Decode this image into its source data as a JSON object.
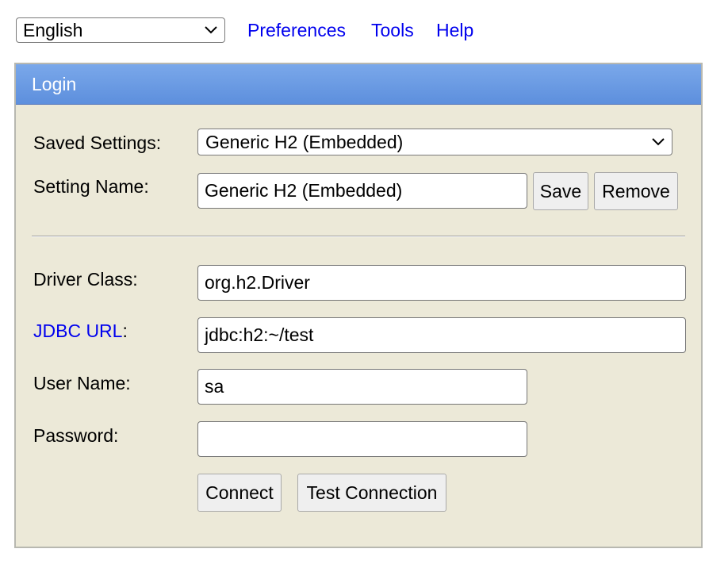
{
  "toolbar": {
    "language": "English",
    "links": {
      "preferences": "Preferences",
      "tools": "Tools",
      "help": "Help"
    }
  },
  "login": {
    "title": "Login",
    "saved_settings": {
      "label": "Saved Settings:",
      "value": "Generic H2 (Embedded)"
    },
    "setting_name": {
      "label": "Setting Name:",
      "value": "Generic H2 (Embedded)",
      "save_label": "Save",
      "remove_label": "Remove"
    },
    "driver_class": {
      "label": "Driver Class:",
      "value": "org.h2.Driver"
    },
    "jdbc_url": {
      "link_label": "JDBC URL",
      "colon": ":",
      "value": "jdbc:h2:~/test"
    },
    "user_name": {
      "label": "User Name:",
      "value": "sa"
    },
    "password": {
      "label": "Password:",
      "value": ""
    },
    "buttons": {
      "connect": "Connect",
      "test_connection": "Test Connection"
    }
  },
  "colors": {
    "link": "#0000ee",
    "header": "#6a9ae3",
    "panel_bg": "#ece9d8"
  },
  "icons": {
    "dropdown": "chevron-down-icon"
  }
}
